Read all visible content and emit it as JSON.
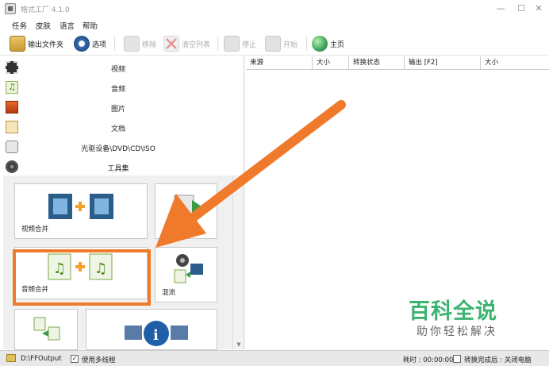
{
  "window": {
    "title": "格式工厂 4.1.0",
    "minimize": "—",
    "maximize": "☐",
    "close": "✕"
  },
  "menu": [
    "任务",
    "皮肤",
    "语言",
    "帮助"
  ],
  "toolbar": {
    "output_folder": "输出文件夹",
    "options": "选项",
    "remove": "移除",
    "clear_list": "清空列表",
    "stop": "停止",
    "start": "开始",
    "home": "主页"
  },
  "categories": [
    "视频",
    "音频",
    "图片",
    "文档",
    "光驱设备\\DVD\\CD\\ISO",
    "工具集"
  ],
  "tiles": {
    "video_merge": "视频合并",
    "audio_merge": "音频合并",
    "mux": "混流"
  },
  "columns": [
    "来源",
    "大小",
    "转换状态",
    "输出 [F2]",
    "大小"
  ],
  "status": {
    "output_path": "D:\\FFOutput",
    "multithread": "使用多线程",
    "elapsed": "耗时 : 00:00:00",
    "after_done": "转换完成后 : 关闭电脑"
  },
  "watermark": {
    "main": "百科全说",
    "sub": "助你轻松解决"
  },
  "colors": {
    "arrow": "#f07a2b",
    "watermark": "#3cb371"
  }
}
